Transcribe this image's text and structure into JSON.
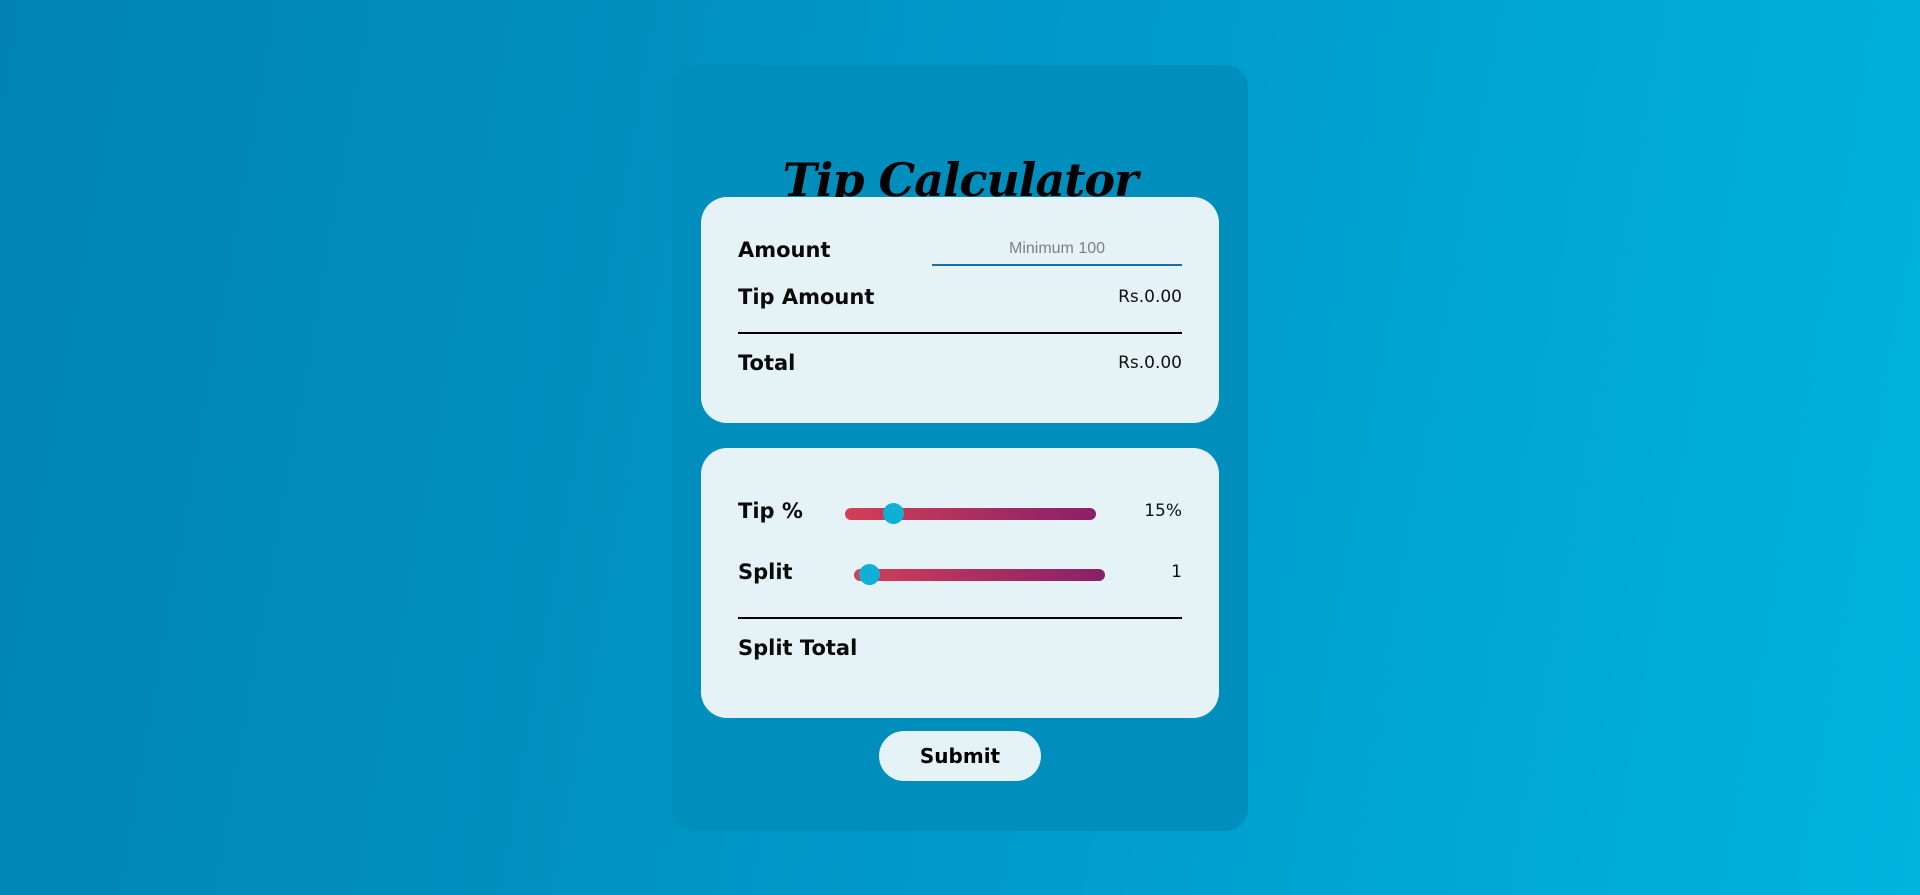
{
  "app": {
    "title": "Tip Calculator"
  },
  "bill": {
    "amount_label": "Amount",
    "amount_value": "",
    "amount_placeholder": "Minimum 100",
    "tip_amount_label": "Tip Amount",
    "tip_amount_value": "Rs.0.00",
    "total_label": "Total",
    "total_value": "Rs.0.00"
  },
  "controls": {
    "tip_label": "Tip %",
    "tip_display": "15%",
    "tip_slider_fraction": 0.15,
    "split_label": "Split",
    "split_display": "1",
    "split_slider_fraction": 0.0,
    "split_total_label": "Split Total",
    "split_total_value": ""
  },
  "actions": {
    "submit_label": "Submit"
  },
  "colors": {
    "background_start": "#0083b4",
    "background_end": "#00b4de",
    "card": "#008ebd",
    "panel": "#e6f3f6",
    "slider_start": "#d43f57",
    "slider_end": "#8a2068",
    "slider_thumb": "#0fb0d8",
    "input_underline": "#1a6fa8"
  }
}
